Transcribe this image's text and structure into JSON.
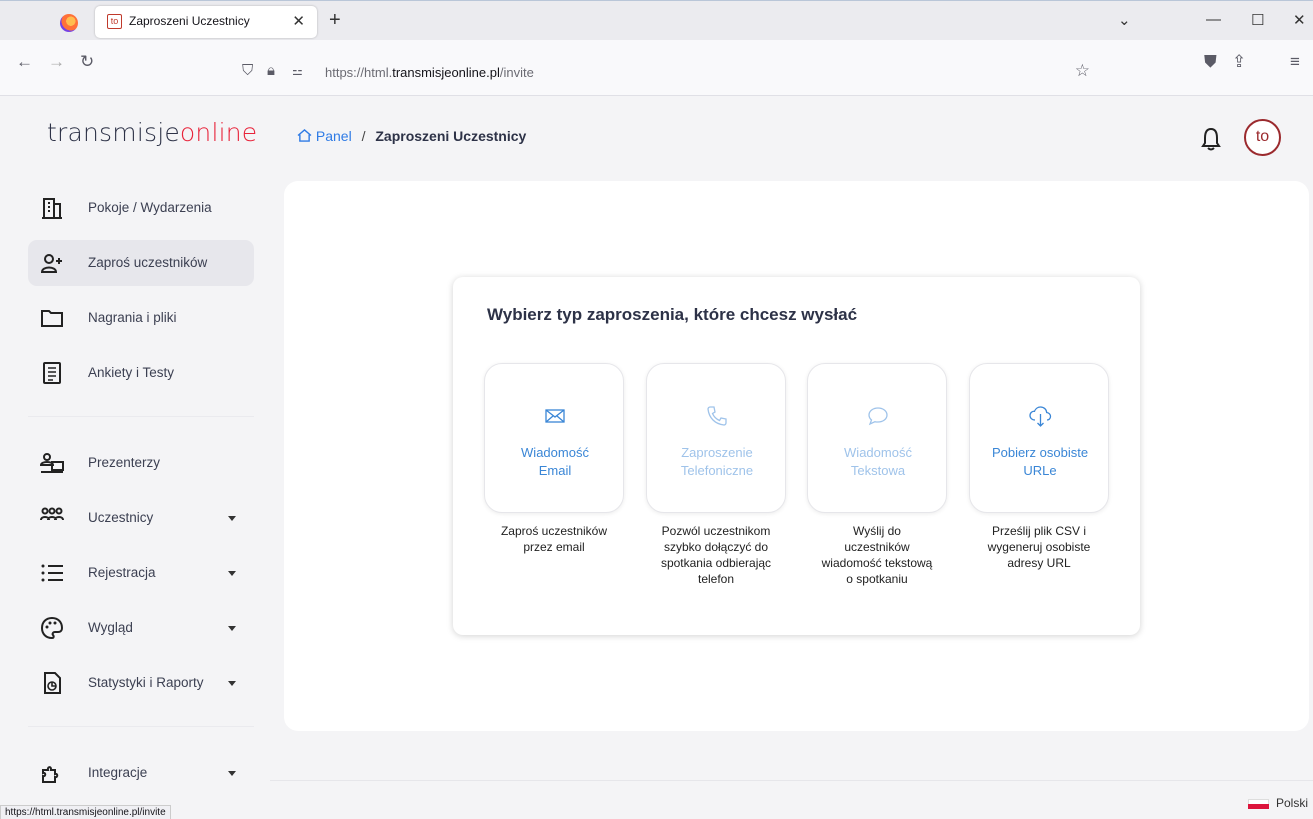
{
  "browser": {
    "tab_title": "Zaproszeni Uczestnicy",
    "tab_favicon_text": "to",
    "url_prefix": "https://html.",
    "url_domain": "transmisjeonline.pl",
    "url_path": "/invite",
    "status_url": "https://html.transmisjeonline.pl/invite"
  },
  "app": {
    "logo_main": "transmisje",
    "logo_accent": "online",
    "avatar_text": "to",
    "accent_color": "#e8233a",
    "link_color": "#2f7be5"
  },
  "breadcrumb": {
    "home": "Panel",
    "separator": "/",
    "current": "Zaproszeni Uczestnicy"
  },
  "sidebar": {
    "items": [
      {
        "label": "Pokoje / Wydarzenia",
        "icon": "building-icon",
        "active": false,
        "has_caret": false
      },
      {
        "label": "Zaproś uczestników",
        "icon": "user-plus-icon",
        "active": true,
        "has_caret": false
      },
      {
        "label": "Nagrania i pliki",
        "icon": "folder-icon",
        "active": false,
        "has_caret": false
      },
      {
        "label": "Ankiety i Testy",
        "icon": "list-document-icon",
        "active": false,
        "has_caret": false
      },
      {
        "label": "Prezenterzy",
        "icon": "presenter-icon",
        "active": false,
        "has_caret": false
      },
      {
        "label": "Uczestnicy",
        "icon": "users-group-icon",
        "active": false,
        "has_caret": true
      },
      {
        "label": "Rejestracja",
        "icon": "list-icon",
        "active": false,
        "has_caret": true
      },
      {
        "label": "Wygląd",
        "icon": "palette-icon",
        "active": false,
        "has_caret": true
      },
      {
        "label": "Statystyki i Raporty",
        "icon": "report-icon",
        "active": false,
        "has_caret": true
      },
      {
        "label": "Integracje",
        "icon": "puzzle-icon",
        "active": false,
        "has_caret": true
      }
    ]
  },
  "invite": {
    "title": "Wybierz typ zaproszenia, które chcesz wysłać",
    "options": [
      {
        "label_line1": "Wiadomość",
        "label_line2": "Email",
        "icon": "mail-icon",
        "enabled": true,
        "desc_line1": "Zaproś uczestników",
        "desc_line2": "przez email",
        "desc_line3": "",
        "desc_line4": ""
      },
      {
        "label_line1": "Zaproszenie",
        "label_line2": "Telefoniczne",
        "icon": "phone-icon",
        "enabled": false,
        "desc_line1": "Pozwól uczestnikom",
        "desc_line2": "szybko dołączyć do",
        "desc_line3": "spotkania odbierając",
        "desc_line4": "telefon"
      },
      {
        "label_line1": "Wiadomość",
        "label_line2": "Tekstowa",
        "icon": "chat-bubble-icon",
        "enabled": false,
        "desc_line1": "Wyślij do",
        "desc_line2": "uczestników",
        "desc_line3": "wiadomość tekstową",
        "desc_line4": "o spotkaniu"
      },
      {
        "label_line1": "Pobierz osobiste",
        "label_line2": "URLe",
        "icon": "cloud-download-icon",
        "enabled": true,
        "desc_line1": "Prześlij plik CSV i",
        "desc_line2": "wygeneruj osobiste",
        "desc_line3": "adresy URL",
        "desc_line4": ""
      }
    ]
  },
  "footer": {
    "language": "Polski"
  }
}
